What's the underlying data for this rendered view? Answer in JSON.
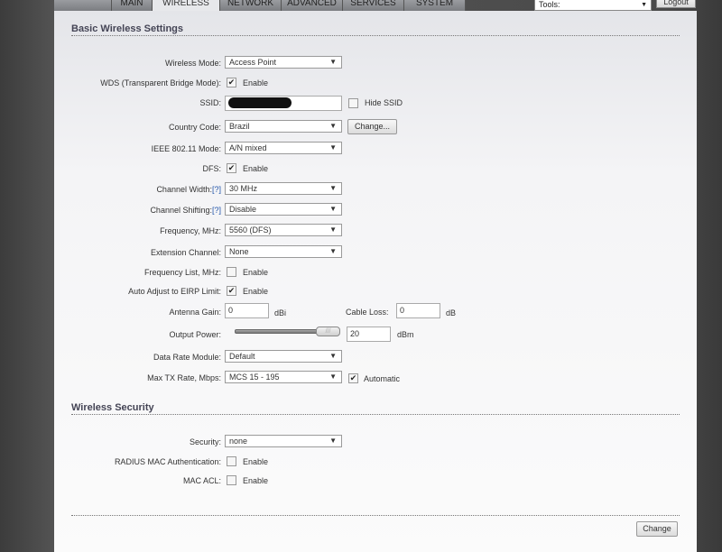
{
  "tabs": [
    "MAIN",
    "WIRELESS",
    "NETWORK",
    "ADVANCED",
    "SERVICES",
    "SYSTEM"
  ],
  "tools_select": "Tools:",
  "logout": "Logout",
  "basic": {
    "title": "Basic Wireless Settings",
    "wireless_mode": {
      "label": "Wireless Mode:",
      "value": "Access Point"
    },
    "wds": {
      "label": "WDS (Transparent Bridge Mode):",
      "checked": true,
      "text": "Enable"
    },
    "ssid": {
      "label": "SSID:",
      "value": "",
      "hide_text": "Hide SSID",
      "hide_checked": false
    },
    "country": {
      "label": "Country Code:",
      "value": "Brazil",
      "button": "Change..."
    },
    "ieee": {
      "label": "IEEE 802.11 Mode:",
      "value": "A/N mixed"
    },
    "dfs": {
      "label": "DFS:",
      "checked": true,
      "text": "Enable"
    },
    "channel_width": {
      "label": "Channel Width:",
      "help": "[?]",
      "value": "30 MHz"
    },
    "channel_shifting": {
      "label": "Channel Shifting:",
      "help": "[?]",
      "value": "Disable"
    },
    "frequency": {
      "label": "Frequency, MHz:",
      "value": "5560 (DFS)"
    },
    "extension": {
      "label": "Extension Channel:",
      "value": "None"
    },
    "freq_list": {
      "label": "Frequency List, MHz:",
      "checked": false,
      "text": "Enable"
    },
    "auto_eirp": {
      "label": "Auto Adjust to EIRP Limit:",
      "checked": true,
      "text": "Enable"
    },
    "antenna_gain": {
      "label": "Antenna Gain:",
      "value": "0",
      "unit": "dBi"
    },
    "cable_loss": {
      "label": "Cable Loss:",
      "value": "0",
      "unit": "dB"
    },
    "output_power": {
      "label": "Output Power:",
      "value": "20",
      "unit": "dBm",
      "slider_fraction": 1.0
    },
    "data_rate": {
      "label": "Data Rate Module:",
      "value": "Default"
    },
    "max_tx": {
      "label": "Max TX Rate, Mbps:",
      "value": "MCS 15 - 195",
      "auto_checked": true,
      "auto_text": "Automatic"
    }
  },
  "security": {
    "title": "Wireless Security",
    "security": {
      "label": "Security:",
      "value": "none"
    },
    "radius": {
      "label": "RADIUS MAC Authentication:",
      "checked": false,
      "text": "Enable"
    },
    "mac_acl": {
      "label": "MAC ACL:",
      "checked": false,
      "text": "Enable"
    }
  },
  "change_button": "Change"
}
